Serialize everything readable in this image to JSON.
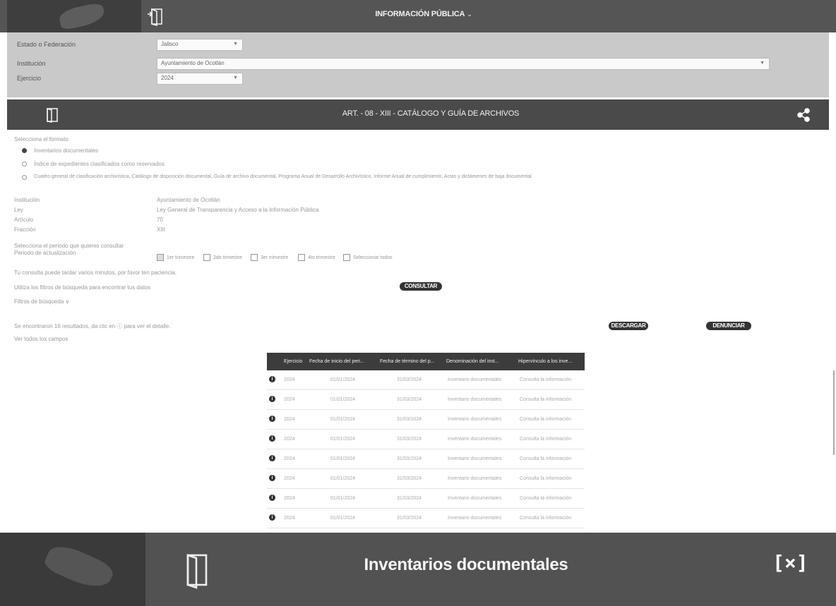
{
  "header": {
    "title": "INFORMACIÓN PÚBLICA",
    "caret": "⌄",
    "logo_icon": "mexico-map-icon",
    "exit_icon": "door-exit-icon"
  },
  "filters": {
    "estado_label": "Estado o Federación",
    "estado_value": "Jalisco",
    "institucion_label": "Institución",
    "institucion_value": "Ayuntamiento de Ocotlán",
    "ejercicio_label": "Ejercicio",
    "ejercicio_value": "2024"
  },
  "article": {
    "title": "ART. - 08 - XIII - CATÁLOGO Y GUÍA DE ARCHIVOS",
    "icon": "door-icon",
    "share_icon": "share-icon"
  },
  "formato": {
    "heading": "Selecciona el formato",
    "options": [
      {
        "label": "Inventarios documentales",
        "selected": true
      },
      {
        "label": "Índice de expedientes clasificados como reservados",
        "selected": false
      },
      {
        "label": "Cuadro general de clasificación archivística, Catálogo de disposición documental, Guía de archivo documental, Programa Anual de Desarrollo Archivístico, Informe Anual de cumplimiento, Actas y dictámenes de baja documental",
        "selected": false
      }
    ]
  },
  "info": [
    {
      "label": "Institución",
      "value": "Ayuntamiento de Ocotlán"
    },
    {
      "label": "Ley",
      "value": "Ley General de Transparencia y Acceso a la Información Pública"
    },
    {
      "label": "Artículo",
      "value": "70"
    },
    {
      "label": "Fracción",
      "value": "XIII"
    }
  ],
  "periodo": {
    "hint": "Selecciona el periodo que quieres consultar",
    "label": "Periodo de actualización",
    "options": [
      {
        "label": "1er trimestre",
        "checked": true
      },
      {
        "label": "2do trimestre",
        "checked": false
      },
      {
        "label": "3er trimestre",
        "checked": false
      },
      {
        "label": "4to trimestre",
        "checked": false
      },
      {
        "label": "Seleccionar todos",
        "checked": false
      }
    ]
  },
  "search": {
    "hint": "Tu consulta puede tardar varios minutos, por favor ten paciencia.",
    "filters_hint": "Utiliza los filtros de búsqueda para encontrar tus datos",
    "filters_toggle": "Filtros de búsqueda ∨",
    "consult_button": "CONSULTAR"
  },
  "results": {
    "summary": "Se encontraron 16 resultados, da clic en ⓘ para ver el detalle.",
    "columns_hint": "Ver todos los campos",
    "download_button": "DESCARGAR",
    "report_button": "DENUNCIAR"
  },
  "table": {
    "headers": [
      "Ejercicio",
      "Fecha de inicio del peri...",
      "Fecha de término del p...",
      "Denominación del inst...",
      "Hipervínculo a los inve..."
    ],
    "rows": [
      [
        "2024",
        "01/01/2024",
        "31/03/2024",
        "Inventario documentales",
        "Consulta la información"
      ],
      [
        "2024",
        "01/01/2024",
        "31/03/2024",
        "Inventario documentales",
        "Consulta la información"
      ],
      [
        "2024",
        "01/01/2024",
        "31/03/2024",
        "Inventario documentales",
        "Consulta la información"
      ],
      [
        "2024",
        "01/01/2024",
        "31/03/2024",
        "Inventario documentales",
        "Consulta la información"
      ],
      [
        "2024",
        "01/01/2024",
        "31/03/2024",
        "Inventario documentales",
        "Consulta la información"
      ],
      [
        "2024",
        "01/01/2024",
        "31/03/2024",
        "Inventario documentales",
        "Consulta la información"
      ],
      [
        "2024",
        "01/01/2024",
        "31/03/2024",
        "Inventario documentales",
        "Consulta la información"
      ],
      [
        "2024",
        "01/01/2024",
        "31/03/2024",
        "Inventario documentales",
        "Consulta la información"
      ]
    ]
  },
  "modal": {
    "title": "Inventarios documentales",
    "close_label": "[×]",
    "icon": "door-icon"
  }
}
